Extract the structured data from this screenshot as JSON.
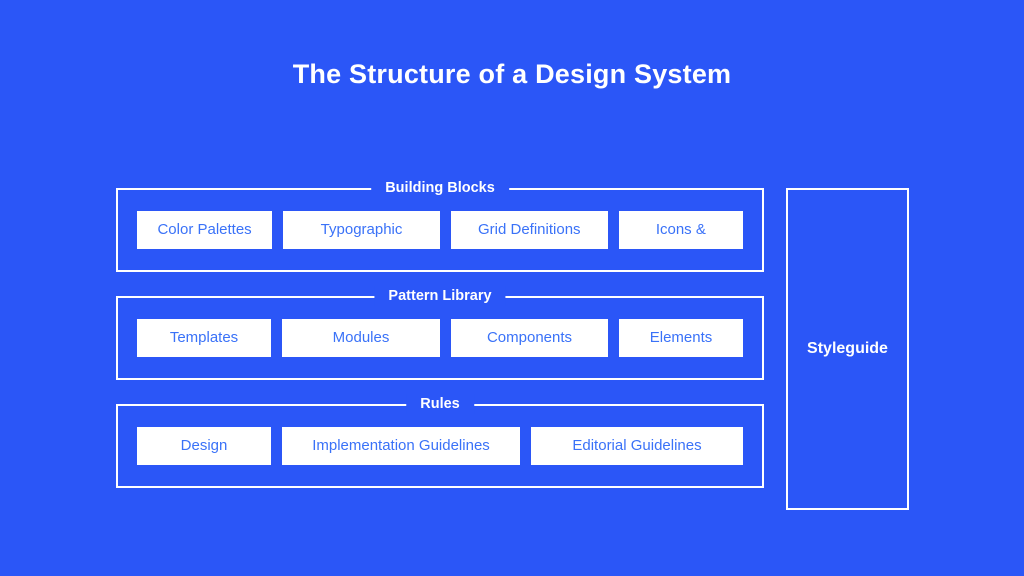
{
  "slide": {
    "title": "The Structure of a Design System",
    "background_color": "#2b56f7",
    "line_color": "#ffffff",
    "chip_background": "#ffffff",
    "chip_text_color": "#3a72f8"
  },
  "groups": [
    {
      "legend": "Building Blocks",
      "items": [
        {
          "label": "Color Palettes"
        },
        {
          "label": "Typographic"
        },
        {
          "label": "Grid Definitions"
        },
        {
          "label": "Icons &"
        }
      ]
    },
    {
      "legend": "Pattern Library",
      "items": [
        {
          "label": "Templates"
        },
        {
          "label": "Modules"
        },
        {
          "label": "Components"
        },
        {
          "label": "Elements"
        }
      ]
    },
    {
      "legend": "Rules",
      "items": [
        {
          "label": "Design"
        },
        {
          "label": "Implementation Guidelines"
        },
        {
          "label": "Editorial Guidelines"
        }
      ]
    }
  ],
  "styleguide": {
    "label": "Styleguide"
  }
}
